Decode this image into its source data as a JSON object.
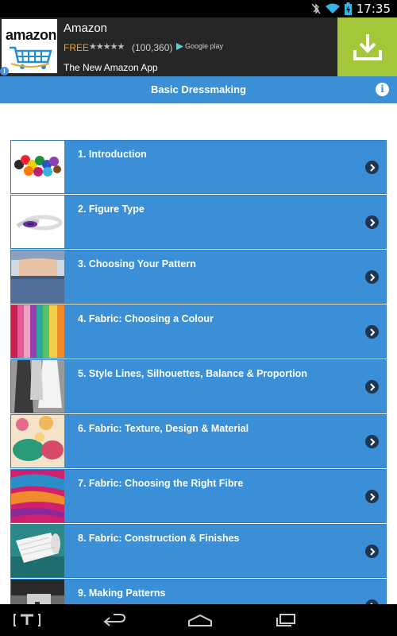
{
  "status_bar": {
    "time": "17:35",
    "icons": [
      "bluetooth-off-icon",
      "wifi-icon",
      "battery-charging-icon"
    ]
  },
  "ad": {
    "logo_text": "amazon",
    "title": "Amazon",
    "price": "FREE",
    "rating_stars": "★★★★★",
    "review_count": "(100,360)",
    "store_label": "Google play",
    "subtitle": "The New Amazon App",
    "download_icon": "download-icon",
    "accent_color": "#a4c639"
  },
  "appbar": {
    "title": "Basic Dressmaking",
    "info_icon": "info-icon",
    "color": "#3a8fd6"
  },
  "chapters": [
    {
      "label": "1. Introduction",
      "thumb": "thread-spools"
    },
    {
      "label": "2. Figure Type",
      "thumb": "tape-measure"
    },
    {
      "label": "3. Choosing Your Pattern",
      "thumb": "waist-jeans"
    },
    {
      "label": "4. Fabric: Choosing a Colour",
      "thumb": "fabric-rolls"
    },
    {
      "label": "5. Style Lines, Silhouettes, Balance & Proportion",
      "thumb": "dresses"
    },
    {
      "label": "6. Fabric: Texture, Design & Material",
      "thumb": "textured-fabric"
    },
    {
      "label": "7. Fabric: Choosing the Right Fibre",
      "thumb": "silk-fabric"
    },
    {
      "label": "8. Fabric: Construction & Finishes",
      "thumb": "yarn-cone"
    },
    {
      "label": "9. Making Patterns",
      "thumb": "sewing-machine"
    }
  ],
  "navbar": {
    "items": [
      "t-logo-icon",
      "back-icon",
      "home-icon",
      "recents-icon"
    ]
  }
}
